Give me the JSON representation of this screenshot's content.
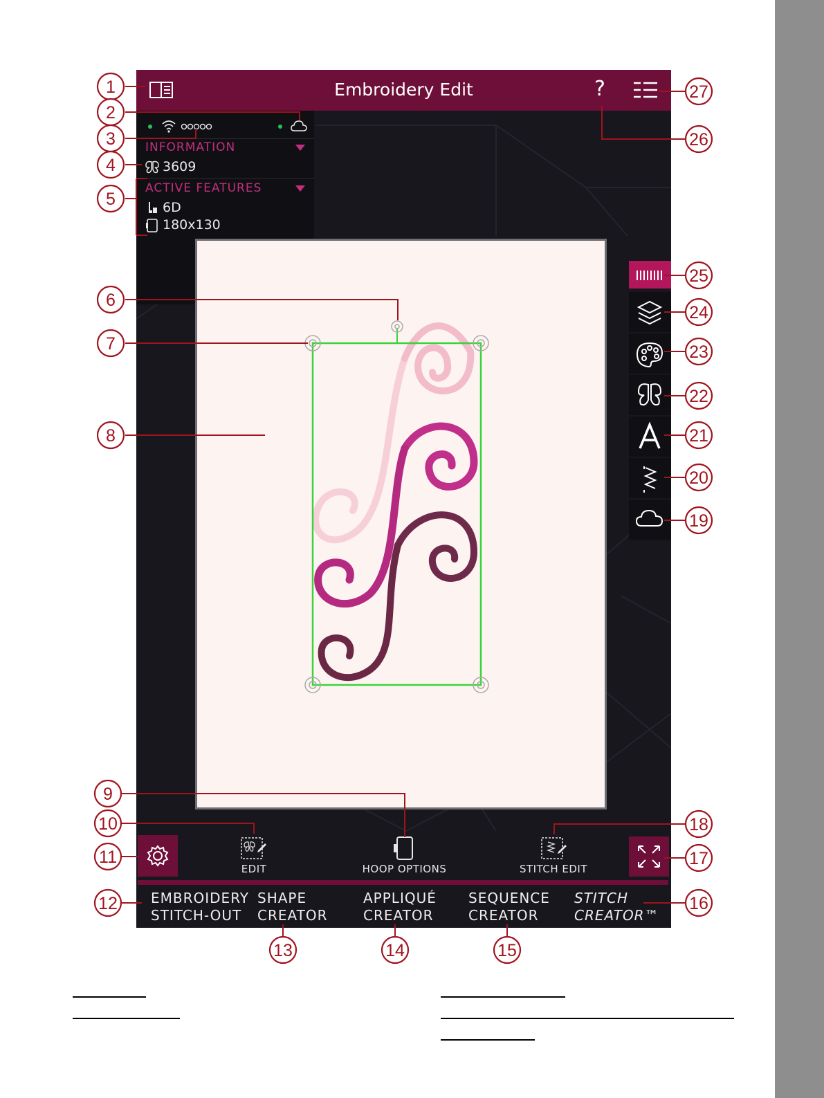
{
  "app": {
    "title": "Embroidery Edit",
    "help_label": "?"
  },
  "info_panel": {
    "information_header": "INFORMATION",
    "stitch_count": "3609",
    "active_features_header": "ACTIVE FEATURES",
    "presser_foot": "6D",
    "hoop_size": "180x130"
  },
  "toolbar": {
    "edit_label": "EDIT",
    "hoop_options_label": "HOOP OPTIONS",
    "stitch_edit_label": "STITCH EDIT"
  },
  "modes": {
    "embroidery_stitchout": [
      "EMBROIDERY",
      "STITCH-OUT"
    ],
    "shape_creator": [
      "SHAPE",
      "CREATOR"
    ],
    "applique_creator": [
      "APPLIQUÉ",
      "CREATOR"
    ],
    "sequence_creator": [
      "SEQUENCE",
      "CREATOR"
    ],
    "stitch_creator": [
      "STITCH",
      "CREATOR™"
    ]
  },
  "right_rail_icons": [
    "stitch-bars-icon",
    "layers-icon",
    "palette-icon",
    "butterfly-icon",
    "letter-a-icon",
    "zigzag-stitch-icon",
    "cloud-icon"
  ],
  "callouts": [
    "1",
    "2",
    "3",
    "4",
    "5",
    "6",
    "7",
    "8",
    "9",
    "10",
    "11",
    "12",
    "13",
    "14",
    "15",
    "16",
    "17",
    "18",
    "19",
    "20",
    "21",
    "22",
    "23",
    "24",
    "25",
    "26",
    "27"
  ],
  "colors": {
    "brand": "#6d0f38",
    "accent": "#c32f7e",
    "screen_bg": "#17171d",
    "hoop_canvas": "#fdf4f2",
    "selection": "#3ad33a",
    "callout": "#a0141e"
  }
}
